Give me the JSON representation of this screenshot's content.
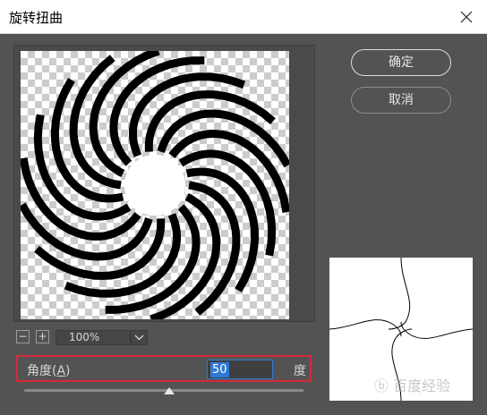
{
  "window": {
    "title": "旋转扭曲",
    "close_icon": "close-icon"
  },
  "preview": {
    "zoom_out_label": "−",
    "zoom_in_label": "+",
    "zoom_value": "100%"
  },
  "buttons": {
    "ok_label": "确定",
    "cancel_label": "取消"
  },
  "angle": {
    "label": "角度(",
    "mnemonic": "A",
    "label_close": ")",
    "value": "50",
    "unit": "度",
    "slider_fraction": 0.52
  },
  "watermark": "ⓑ 百度经验"
}
